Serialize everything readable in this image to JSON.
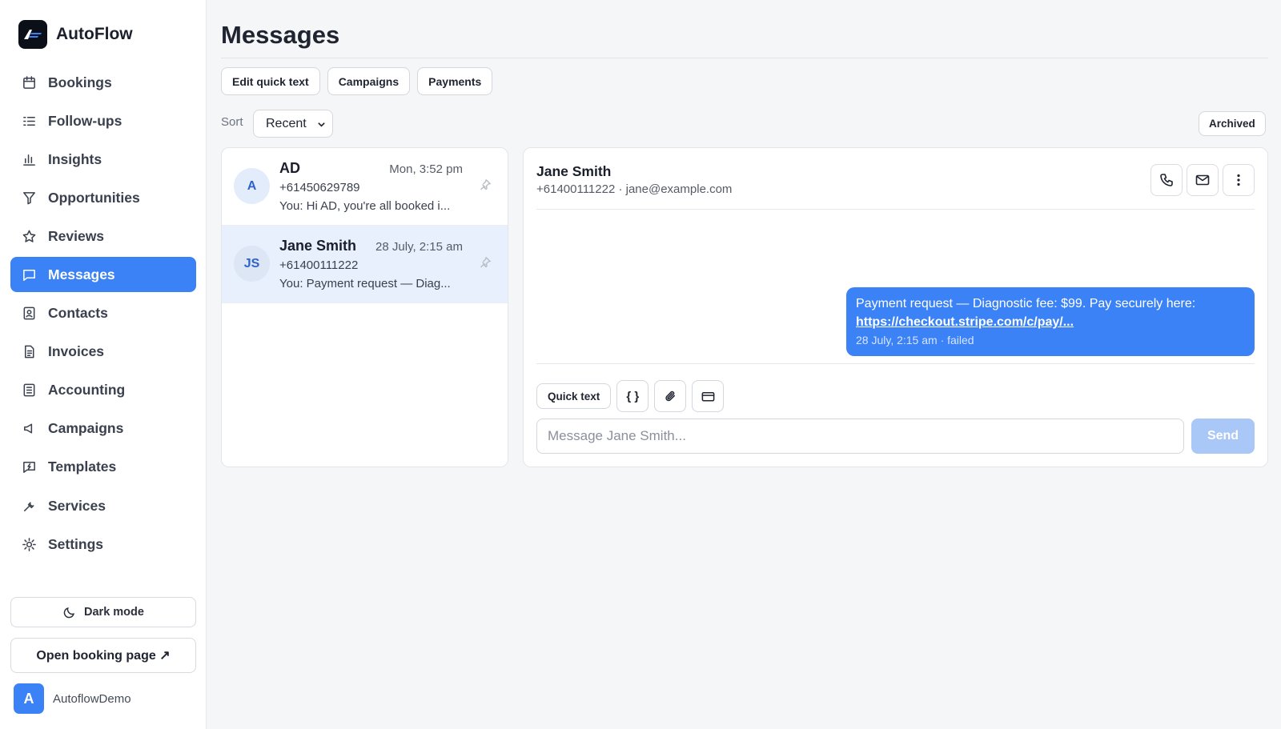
{
  "app": {
    "name": "AutoFlow",
    "logo_text": "AF",
    "accent_color": "#3b82f6"
  },
  "sidebar": {
    "items": [
      {
        "label": "Bookings",
        "icon": "calendar-icon"
      },
      {
        "label": "Follow-ups",
        "icon": "list-check-icon"
      },
      {
        "label": "Insights",
        "icon": "bar-chart-icon"
      },
      {
        "label": "Opportunities",
        "icon": "funnel-icon"
      },
      {
        "label": "Reviews",
        "icon": "star-icon"
      },
      {
        "label": "Messages",
        "icon": "chat-icon",
        "active": true
      },
      {
        "label": "Contacts",
        "icon": "contact-card-icon"
      },
      {
        "label": "Invoices",
        "icon": "document-icon"
      },
      {
        "label": "Accounting",
        "icon": "ledger-icon"
      },
      {
        "label": "Campaigns",
        "icon": "megaphone-icon"
      },
      {
        "label": "Templates",
        "icon": "template-icon"
      },
      {
        "label": "Services",
        "icon": "wrench-icon"
      },
      {
        "label": "Settings",
        "icon": "gear-icon"
      }
    ],
    "dark_mode_label": "Dark mode",
    "open_booking_label": "Open booking page ↗",
    "user": {
      "initial": "A",
      "name": "AutoflowDemo"
    }
  },
  "main": {
    "title": "Messages",
    "top_buttons": [
      "Edit quick text",
      "Campaigns",
      "Payments"
    ],
    "sort_label": "Sort",
    "sort_value": "Recent",
    "archived_label": "Archived"
  },
  "conversations": [
    {
      "initials": "A",
      "name": "AD",
      "time": "Mon, 3:52 pm",
      "phone": "+61450629789",
      "preview": "You: Hi AD, you're all booked i...",
      "selected": false
    },
    {
      "initials": "JS",
      "name": "Jane Smith",
      "time": "28 July, 2:15 am",
      "phone": "+61400111222",
      "preview": "You: Payment request — Diag...",
      "selected": true
    }
  ],
  "chat": {
    "name": "Jane Smith",
    "subtitle": "+61400111222 · jane@example.com",
    "message": {
      "text": "Payment request — Diagnostic fee: $99. Pay securely here:",
      "link": "https://checkout.stripe.com/c/pay/...",
      "meta": "28 July, 2:15 am · failed"
    },
    "quick_text_label": "Quick text",
    "variables_label": "{ }",
    "input_placeholder": "Message Jane Smith...",
    "send_label": "Send"
  }
}
